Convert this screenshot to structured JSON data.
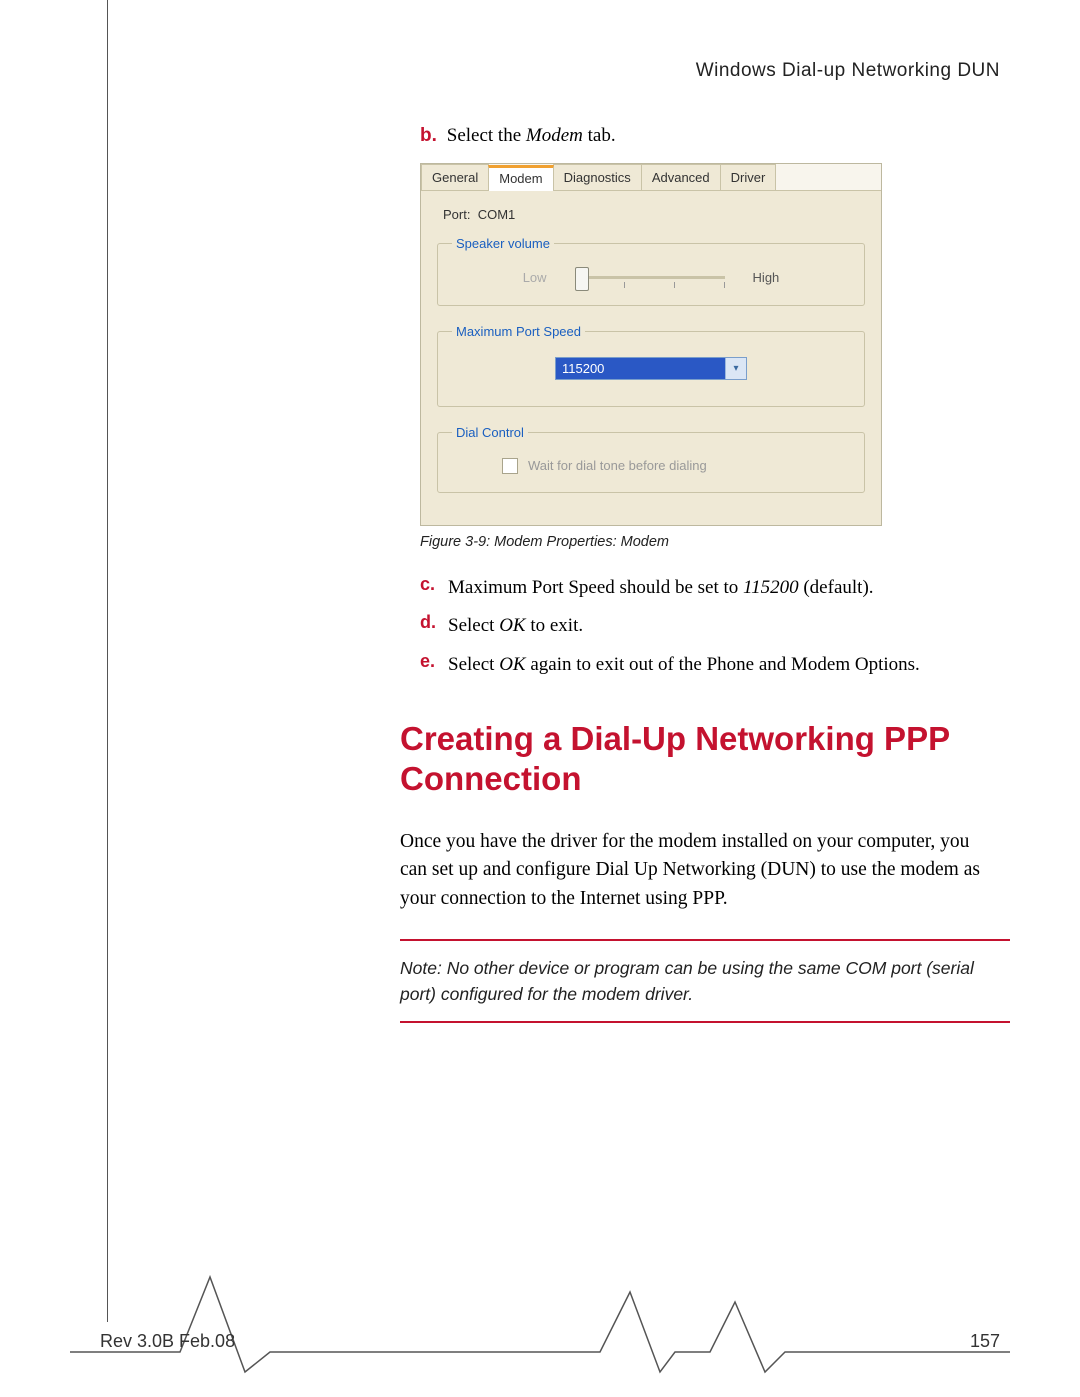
{
  "header": {
    "title": "Windows Dial-up Networking DUN"
  },
  "step_b": {
    "marker": "b.",
    "prefix": "Select the ",
    "italic": "Modem",
    "suffix": " tab."
  },
  "dialog": {
    "tabs": [
      "General",
      "Modem",
      "Diagnostics",
      "Advanced",
      "Driver"
    ],
    "active_tab_index": 1,
    "port_label": "Port:",
    "port_value": "COM1",
    "speaker_legend": "Speaker volume",
    "speaker_low": "Low",
    "speaker_high": "High",
    "speed_legend": "Maximum Port Speed",
    "speed_value": "115200",
    "dial_legend": "Dial Control",
    "dial_checkbox_label": "Wait for dial tone before dialing"
  },
  "figure_caption": "Figure 3-9: Modem Properties: Modem",
  "steps": [
    {
      "marker": "c.",
      "segments": [
        {
          "t": "Maximum Port Speed should be set to "
        },
        {
          "t": "115200",
          "i": true
        },
        {
          "t": " (default)."
        }
      ]
    },
    {
      "marker": "d.",
      "segments": [
        {
          "t": "Select "
        },
        {
          "t": "OK",
          "i": true
        },
        {
          "t": " to exit."
        }
      ]
    },
    {
      "marker": "e.",
      "segments": [
        {
          "t": "Select "
        },
        {
          "t": "OK",
          "i": true
        },
        {
          "t": " again to exit out of the Phone and Modem Options."
        }
      ]
    }
  ],
  "section_heading": "Creating a Dial-Up Networking PPP Connection",
  "body_para": "Once you have the driver for the modem installed on your computer, you can set up and configure Dial Up Networking (DUN) to use the modem as your connection to the Internet using PPP.",
  "note": "Note:  No other device or program can be using the same COM port (serial port) configured for the modem driver.",
  "footer": {
    "rev": "Rev 3.0B Feb.08",
    "page": "157"
  }
}
